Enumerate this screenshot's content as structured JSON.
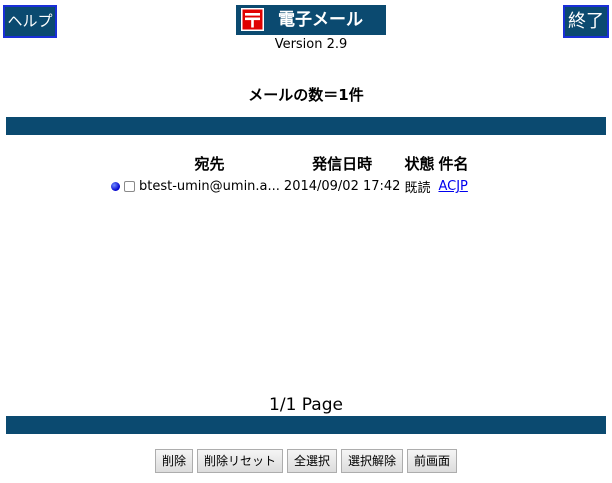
{
  "header": {
    "help_label": "ヘルプ",
    "exit_label": "終了",
    "title": "電子メール",
    "version": "Version 2.9"
  },
  "summary": {
    "mail_count": "メールの数＝1件"
  },
  "table": {
    "headers": {
      "to": "宛先",
      "date": "発信日時",
      "status": "状態",
      "subject": "件名"
    },
    "rows": [
      {
        "to": "btest-umin@umin.a...",
        "date": "2014/09/02 17:42",
        "status": "既読",
        "subject": "ACJP",
        "selected": false
      }
    ]
  },
  "pager": {
    "text": "1/1 Page"
  },
  "actions": {
    "delete": "削除",
    "delete_reset": "削除リセット",
    "select_all": "全選択",
    "deselect": "選択解除",
    "prev_screen": "前画面"
  },
  "colors": {
    "bar": "#0b4a70",
    "link": "#0000ee",
    "unread_dot": "#0000cc"
  }
}
